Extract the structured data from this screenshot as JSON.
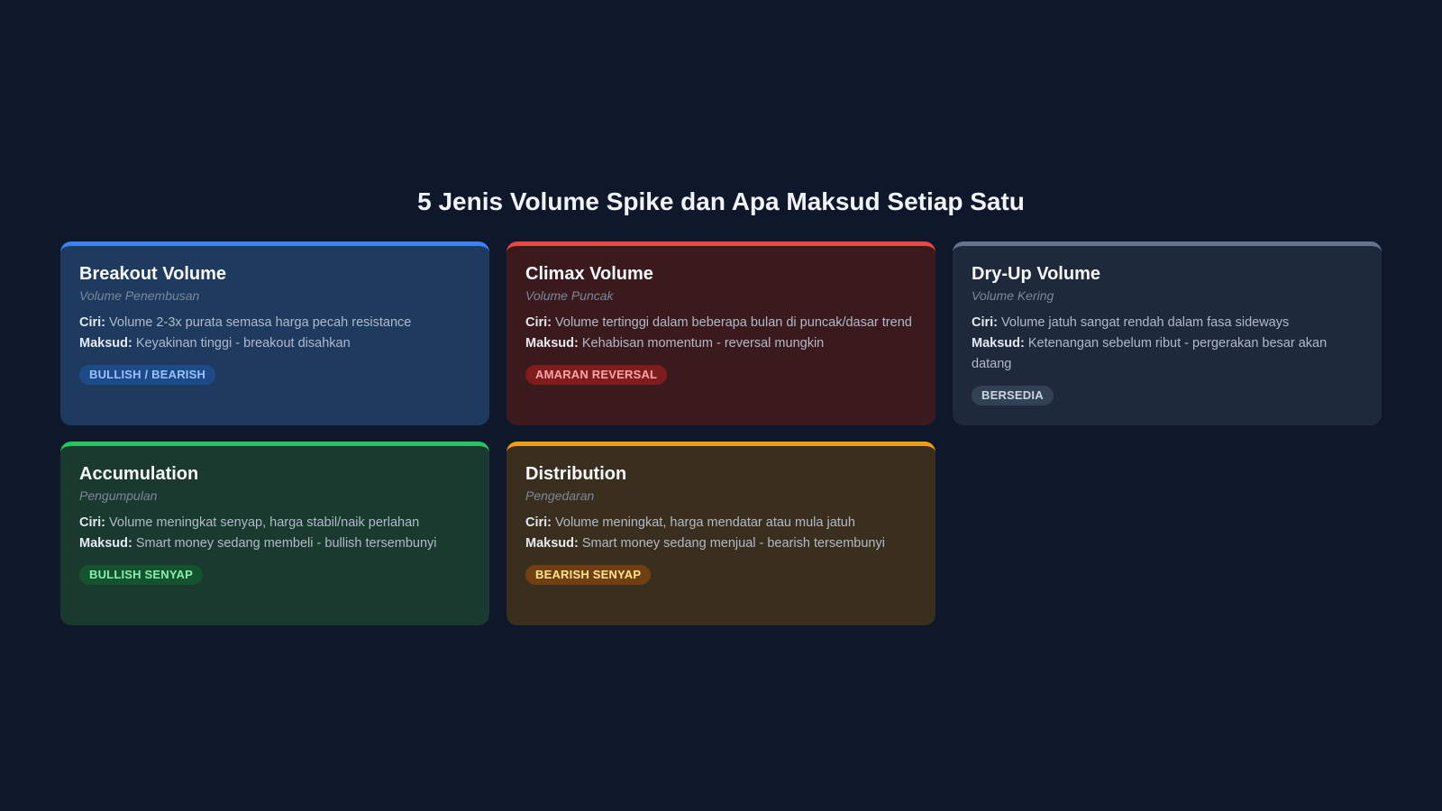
{
  "title": "5 Jenis Volume Spike dan Apa Maksud Setiap Satu",
  "ciri_label": "Ciri:",
  "maksud_label": "Maksud:",
  "cards": [
    {
      "title": "Breakout Volume",
      "subtitle": "Volume Penembusan",
      "ciri": "Volume 2-3x purata semasa harga pecah resistance",
      "maksud": "Keyakinan tinggi - breakout disahkan",
      "badge": "BULLISH / BEARISH",
      "colors": {
        "accent": "#3b82f6",
        "bg": "#1e3a5f",
        "badge_bg": "#1e4a8a",
        "badge_text": "#93c5fd"
      }
    },
    {
      "title": "Climax Volume",
      "subtitle": "Volume Puncak",
      "ciri": "Volume tertinggi dalam beberapa bulan di puncak/dasar trend",
      "maksud": "Kehabisan momentum - reversal mungkin",
      "badge": "AMARAN REVERSAL",
      "colors": {
        "accent": "#ef4444",
        "bg": "#3b1a1e",
        "badge_bg": "#7f1d1d",
        "badge_text": "#fca5a5"
      }
    },
    {
      "title": "Dry-Up Volume",
      "subtitle": "Volume Kering",
      "ciri": "Volume jatuh sangat rendah dalam fasa sideways",
      "maksud": "Ketenangan sebelum ribut - pergerakan besar akan datang",
      "badge": "BERSEDIA",
      "colors": {
        "accent": "#64748b",
        "bg": "#1e293b",
        "badge_bg": "#334155",
        "badge_text": "#cbd5e1"
      }
    },
    {
      "title": "Accumulation",
      "subtitle": "Pengumpulan",
      "ciri": "Volume meningkat senyap, harga stabil/naik perlahan",
      "maksud": "Smart money sedang membeli - bullish tersembunyi",
      "badge": "BULLISH SENYAP",
      "colors": {
        "accent": "#22c55e",
        "bg": "#1b3a2f",
        "badge_bg": "#14532d",
        "badge_text": "#86efac"
      }
    },
    {
      "title": "Distribution",
      "subtitle": "Pengedaran",
      "ciri": "Volume meningkat, harga mendatar atau mula jatuh",
      "maksud": "Smart money sedang menjual - bearish tersembunyi",
      "badge": "BEARISH SENYAP",
      "colors": {
        "accent": "#f59e0b",
        "bg": "#3a2f1e",
        "badge_bg": "#713f12",
        "badge_text": "#fde68a"
      }
    }
  ]
}
